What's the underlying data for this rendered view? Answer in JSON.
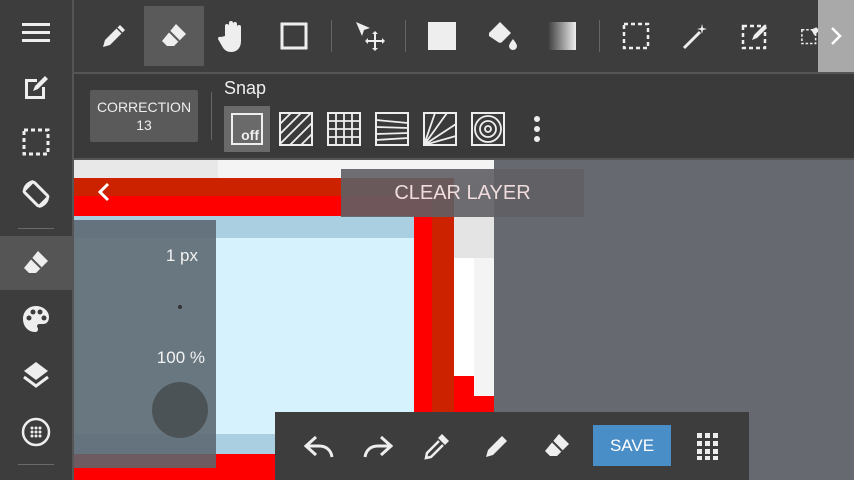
{
  "sidebar": {
    "items": [
      {
        "icon": "menu-icon"
      },
      {
        "icon": "edit-canvas-icon"
      },
      {
        "icon": "selection-icon"
      },
      {
        "icon": "rotate-screen-icon"
      },
      {
        "icon": "eraser-icon",
        "active": true
      },
      {
        "icon": "palette-icon"
      },
      {
        "icon": "layers-icon"
      },
      {
        "icon": "material-icon"
      }
    ]
  },
  "toolbar": {
    "tools": [
      "pen-icon",
      "eraser-icon",
      "hand-icon",
      "shape-icon",
      "move-icon",
      "fill-color-icon",
      "bucket-icon",
      "gradient-icon",
      "select-rect-icon",
      "magic-wand-icon",
      "select-pen-icon",
      "select-eraser-icon"
    ],
    "active_tool": "eraser-icon"
  },
  "subbar": {
    "correction_label": "CORRECTION",
    "correction_value": "13",
    "snap_label": "Snap",
    "snap_off_label": "off"
  },
  "brush_panel": {
    "size": "1 px",
    "opacity": "100 %"
  },
  "clear_layer_label": "CLEAR LAYER",
  "bottom_bar": {
    "save_label": "SAVE"
  },
  "colors": {
    "accent": "#4a8ec8",
    "toolbar_bg": "#3d3d3d",
    "canvas_red": "#ff0000",
    "canvas_darkred": "#cc2200",
    "canvas_light": "#d6f2fc"
  }
}
